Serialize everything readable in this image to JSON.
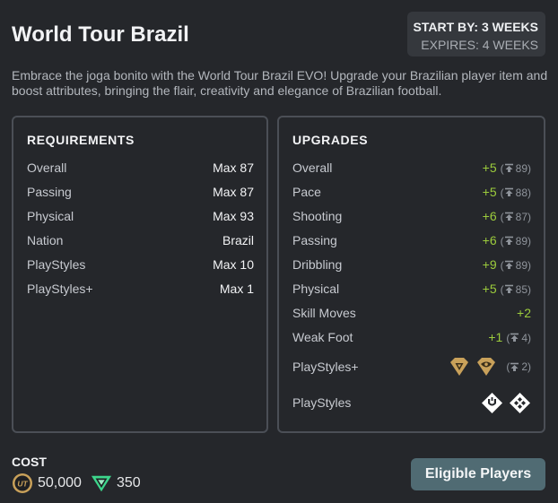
{
  "header": {
    "title": "World Tour Brazil",
    "start_by": "START BY: 3 WEEKS",
    "expires": "EXPIRES: 4 WEEKS"
  },
  "description": "Embrace the joga bonito with the World Tour Brazil EVO! Upgrade your Brazilian player item and boost attributes, bringing the flair, creativity and elegance of Brazilian football.",
  "requirements": {
    "title": "REQUIREMENTS",
    "rows": [
      {
        "label": "Overall",
        "value": "Max 87"
      },
      {
        "label": "Passing",
        "value": "Max 87"
      },
      {
        "label": "Physical",
        "value": "Max 93"
      },
      {
        "label": "Nation",
        "value": "Brazil"
      },
      {
        "label": "PlayStyles",
        "value": "Max 10"
      },
      {
        "label": "PlayStyles+",
        "value": "Max 1"
      }
    ]
  },
  "upgrades": {
    "title": "UPGRADES",
    "rows": [
      {
        "label": "Overall",
        "value": "+5",
        "cap": "89"
      },
      {
        "label": "Pace",
        "value": "+5",
        "cap": "88"
      },
      {
        "label": "Shooting",
        "value": "+6",
        "cap": "87"
      },
      {
        "label": "Passing",
        "value": "+6",
        "cap": "89"
      },
      {
        "label": "Dribbling",
        "value": "+9",
        "cap": "89"
      },
      {
        "label": "Physical",
        "value": "+5",
        "cap": "85"
      },
      {
        "label": "Skill Moves",
        "value": "+2"
      },
      {
        "label": "Weak Foot",
        "value": "+1",
        "cap": "4"
      }
    ],
    "playstyles_plus": {
      "label": "PlayStyles+",
      "cap": "2"
    },
    "playstyles": {
      "label": "PlayStyles"
    }
  },
  "cost": {
    "label": "COST",
    "coins": "50,000",
    "points": "350"
  },
  "eligible_button": "Eligible Players",
  "colors": {
    "background": "#25272b",
    "accent_green": "#9ccc3c",
    "gold": "#c9a15a",
    "button": "#506b73"
  }
}
